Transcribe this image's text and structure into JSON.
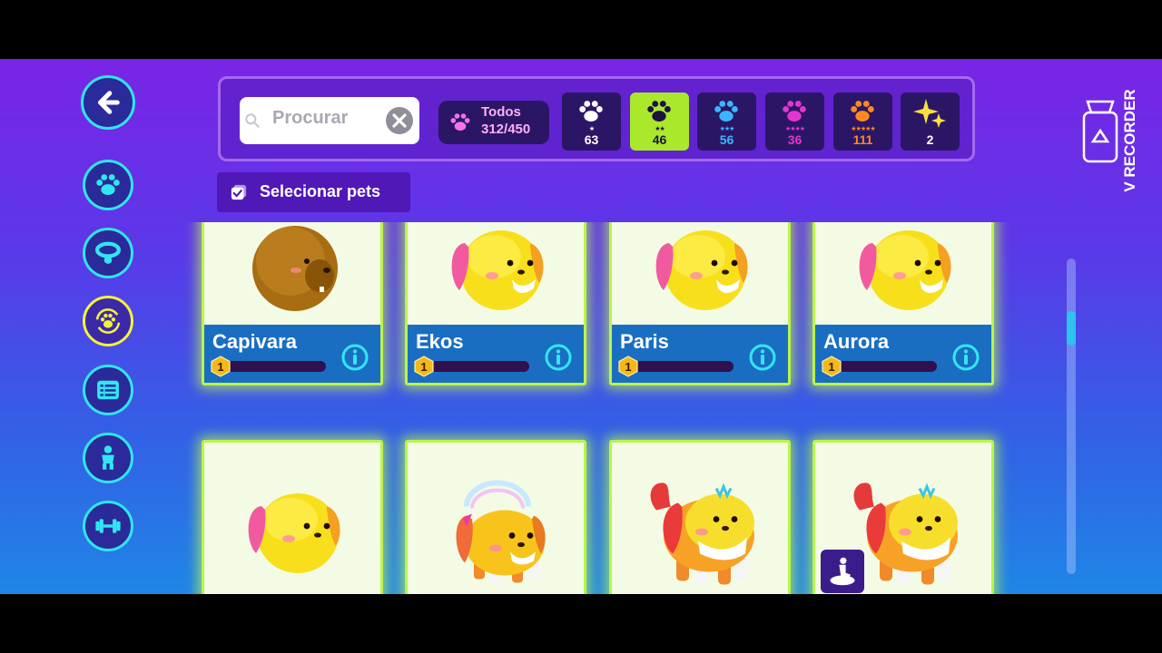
{
  "search": {
    "placeholder": "Procurar"
  },
  "all_filter": {
    "label": "Todos",
    "count": "312/450"
  },
  "rarity_filters": [
    {
      "stars": "★",
      "count": "63",
      "color": "#ffffff"
    },
    {
      "stars": "★★",
      "count": "46",
      "color": "#1d1240",
      "selected": true
    },
    {
      "stars": "★★★",
      "count": "56",
      "color": "#3ab6ff"
    },
    {
      "stars": "★★★★",
      "count": "36",
      "color": "#e236d0"
    },
    {
      "stars": "★★★★★",
      "count": "111",
      "color": "#ff8a1e"
    },
    {
      "stars": "",
      "count": "2",
      "color": "#ffe03a"
    }
  ],
  "select_pets": {
    "label": "Selecionar pets"
  },
  "pets": [
    {
      "name": "Capivara",
      "level": "1",
      "kind": "capybara"
    },
    {
      "name": "Ekos",
      "level": "1",
      "kind": "puppy"
    },
    {
      "name": "Paris",
      "level": "1",
      "kind": "puppy"
    },
    {
      "name": "Aurora",
      "level": "1",
      "kind": "puppy"
    },
    {
      "name": "",
      "level": "",
      "kind": "puppy"
    },
    {
      "name": "",
      "level": "",
      "kind": "puppy-rainbow"
    },
    {
      "name": "",
      "level": "",
      "kind": "puppy-orange"
    },
    {
      "name": "",
      "level": "",
      "kind": "puppy-orange"
    }
  ],
  "recorder": {
    "label": "V RECORDER"
  },
  "colors": {
    "cyan": "#31e6f2",
    "lime": "#a9e82b",
    "card_bar": "#1a6ec2"
  },
  "sidebar_icons": [
    "back-arrow-icon",
    "paw-icon",
    "collar-icon",
    "paw-cycle-icon",
    "list-icon",
    "body-icon",
    "dumbbell-icon"
  ]
}
